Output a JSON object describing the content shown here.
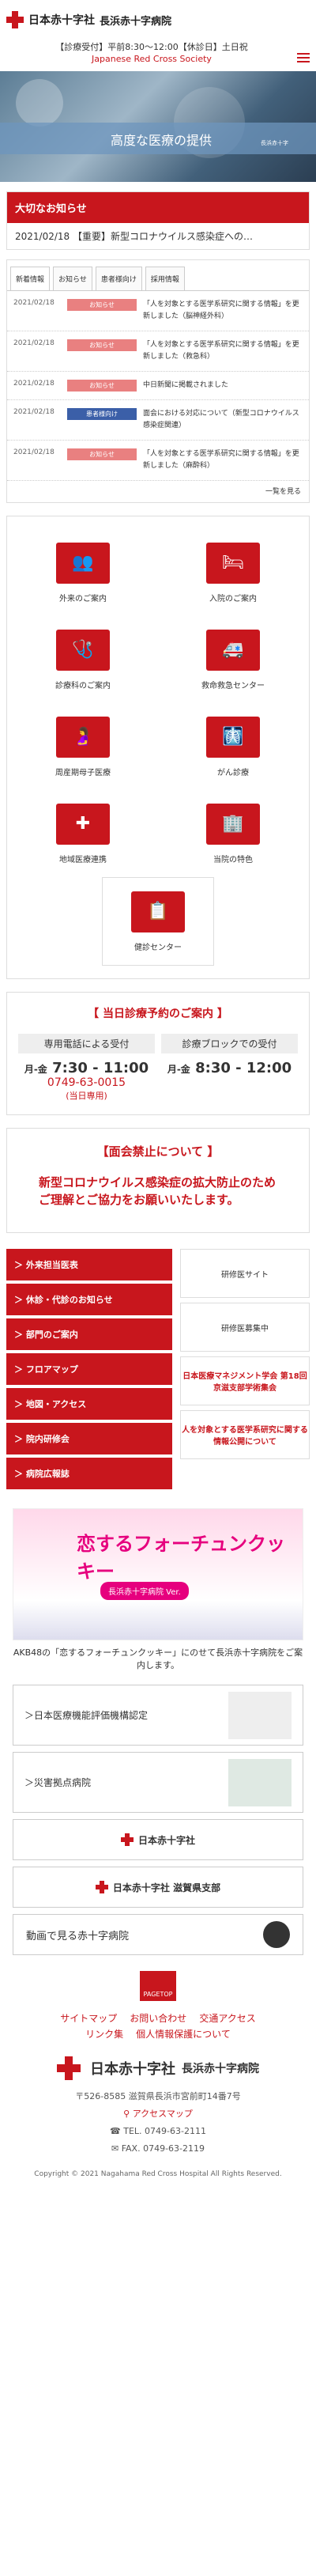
{
  "header": {
    "logo_main": "日本赤十字社",
    "logo_sub": "長浜赤十字病院"
  },
  "info": {
    "line1": "【診療受付】平前8:30〜12:00【休診日】土日祝",
    "line2": "Japanese Red Cross Society"
  },
  "hero": {
    "caption": "高度な医療の提供",
    "sub": "長浜赤十字"
  },
  "notice": {
    "title": "大切なお知らせ",
    "item": "2021/02/18 【重要】新型コロナウイルス感染症への…"
  },
  "news": {
    "tabs": [
      "新着情報",
      "お知らせ",
      "患者様向け",
      "採用情報"
    ],
    "rows": [
      {
        "date": "2021/02/18",
        "badge": "お知らせ",
        "color": "#e98080",
        "text": "「人を対象とする医学系研究に関する情報」を更新しました（脳神経外科）"
      },
      {
        "date": "2021/02/18",
        "badge": "お知らせ",
        "color": "#e98080",
        "text": "「人を対象とする医学系研究に関する情報」を更新しました（救急科）"
      },
      {
        "date": "2021/02/18",
        "badge": "お知らせ",
        "color": "#e98080",
        "text": "中日新聞に掲載されました"
      },
      {
        "date": "2021/02/18",
        "badge": "患者様向け",
        "color": "#3b5fa8",
        "text": "面会における対応について（新型コロナウイルス感染症関連）"
      },
      {
        "date": "2021/02/18",
        "badge": "お知らせ",
        "color": "#e98080",
        "text": "「人を対象とする医学系研究に関する情報」を更新しました（麻酔科）"
      }
    ],
    "more": "一覧を見る"
  },
  "grid": [
    {
      "label": "外来のご案内",
      "icon": "👥"
    },
    {
      "label": "入院のご案内",
      "icon": "🛏"
    },
    {
      "label": "診療科のご案内",
      "icon": "🩺"
    },
    {
      "label": "救命救急センター",
      "icon": "🚑"
    },
    {
      "label": "周産期母子医療",
      "icon": "🤰"
    },
    {
      "label": "がん診療",
      "icon": "🩻"
    },
    {
      "label": "地域医療連携",
      "icon": "✚"
    },
    {
      "label": "当院の特色",
      "icon": "🏢"
    },
    {
      "label": "健診センター",
      "icon": "📋"
    }
  ],
  "reserve": {
    "title": "【 当日診療予約のご案内 】",
    "phone_label": "専用電話による受付",
    "phone_days": "月-金",
    "phone_time": "7:30 - 11:00",
    "tel": "0749-63-0015",
    "tel_note": "(当日専用)",
    "block_label": "診療ブロックでの受付",
    "block_days": "月-金",
    "block_time": "8:30 - 12:00"
  },
  "visit": {
    "title": "【面会禁止について 】",
    "text": "新型コロナウイルス感染症の拡大防止のため ご理解とご協力をお願いいたします。"
  },
  "links": [
    "外来担当医表",
    "休診・代診のお知らせ",
    "部門のご案内",
    "フロアマップ",
    "地図・アクセス",
    "院内研修会",
    "病院広報誌"
  ],
  "banners": [
    "研修医サイト",
    "研修医募集中",
    "日本医療マネジメント学会 第18回 京滋支部学術集会",
    "人を対象とする医学系研究に関する情報公開について"
  ],
  "cookie": {
    "title": "恋するフォーチュンクッキー",
    "pill": "長浜赤十字病院 Ver.",
    "caption": "AKB48の「恋するフォーチュンクッキー」にのせて長浜赤十字病院をご案内します。"
  },
  "boxes": [
    "＞日本医療機能評価機構認定",
    "＞災害拠点病院"
  ],
  "pills": [
    "日本赤十字社",
    "日本赤十字社 滋賀県支部"
  ],
  "video": "動画で見る赤十字病院",
  "footer": {
    "pagetop": "PAGETOP",
    "nav1": [
      "サイトマップ",
      "お問い合わせ",
      "交通アクセス"
    ],
    "nav2": [
      "リンク集",
      "個人情報保護について"
    ],
    "logo_main": "日本赤十字社",
    "logo_sub": "長浜赤十字病院",
    "address": "〒526-8585 滋賀県長浜市宮前町14番7号",
    "access": "アクセスマップ",
    "tel": "TEL. 0749-63-2111",
    "fax": "FAX. 0749-63-2119",
    "copyright": "Copyright © 2021 Nagahama Red Cross Hospital All Rights Reserved."
  }
}
